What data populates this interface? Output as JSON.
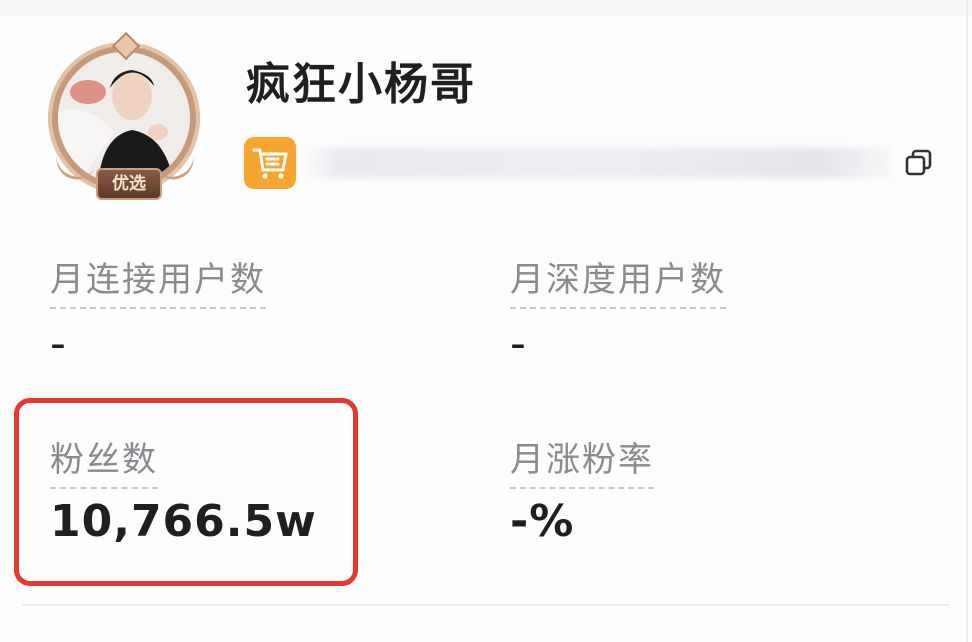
{
  "profile": {
    "name": "疯狂小杨哥",
    "badge": "优选",
    "avatar_icon": "avatar-photo",
    "shop_icon": "shopping-cart-icon",
    "copy_icon": "copy-icon"
  },
  "metrics": [
    {
      "label": "月连接用户数",
      "value": "-"
    },
    {
      "label": "月深度用户数",
      "value": "-"
    },
    {
      "label": "粉丝数",
      "value": "10,766.5w"
    },
    {
      "label": "月涨粉率",
      "value": "-%"
    }
  ],
  "colors": {
    "highlight": "#e23a30",
    "shop_icon": "#f6a531",
    "label_text": "#8a8a8f",
    "value_text": "#1f1f1f"
  }
}
